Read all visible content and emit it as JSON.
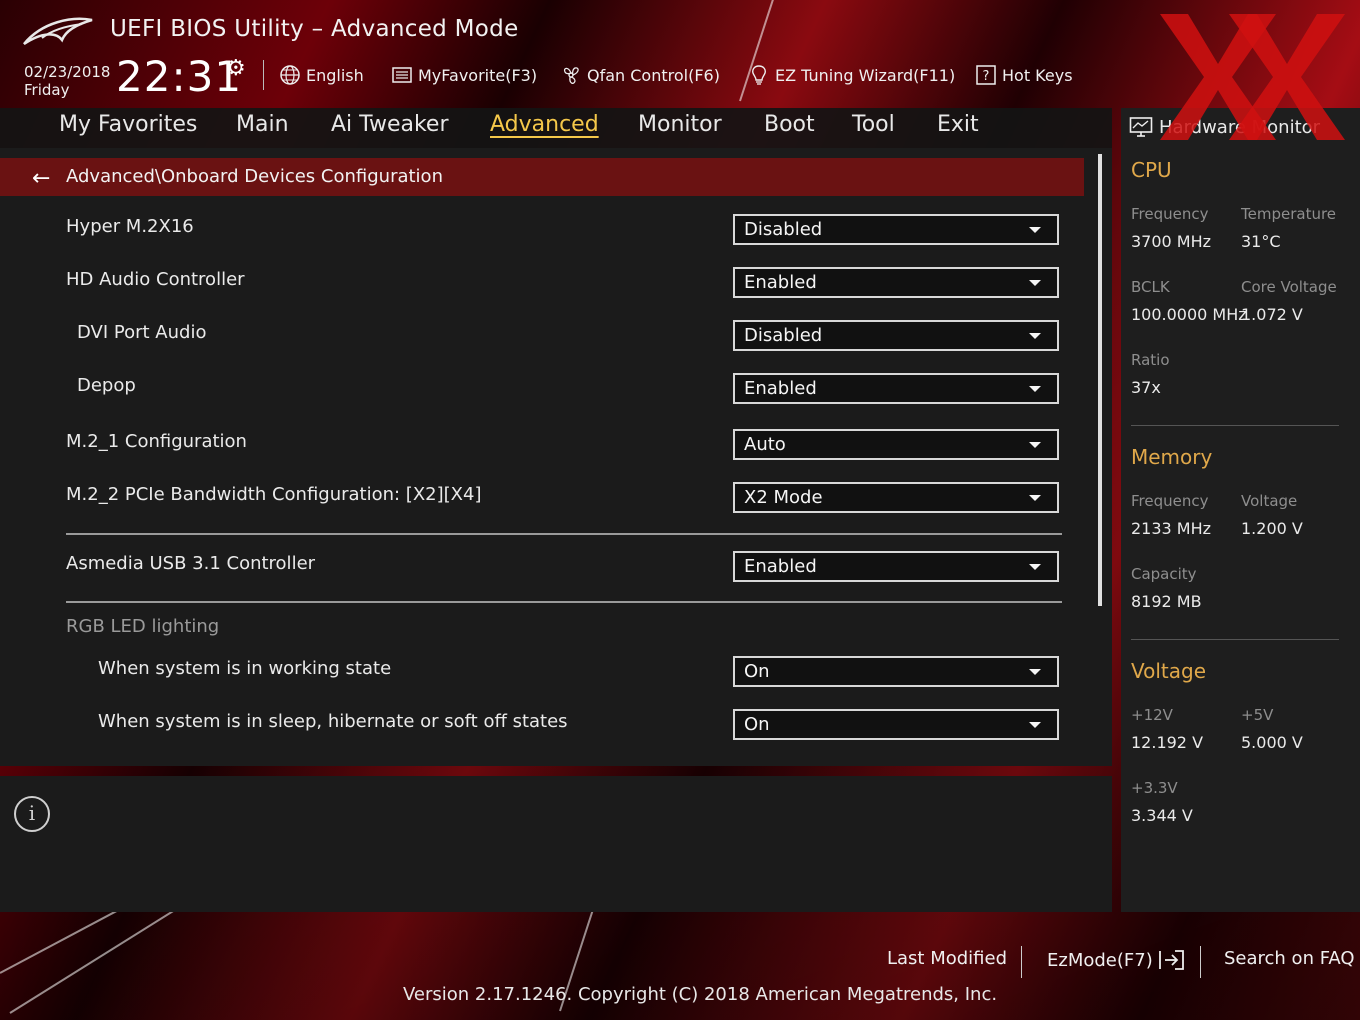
{
  "header": {
    "title": "UEFI BIOS Utility – Advanced Mode",
    "date": "02/23/2018",
    "weekday": "Friday",
    "time": "22:31",
    "toolbar": {
      "language": "English",
      "myfavorite": "MyFavorite(F3)",
      "qfan": "Qfan Control(F6)",
      "ez_tuning": "EZ Tuning Wizard(F11)",
      "hot_keys": "Hot Keys"
    }
  },
  "tabs": [
    "My Favorites",
    "Main",
    "Ai Tweaker",
    "Advanced",
    "Monitor",
    "Boot",
    "Tool",
    "Exit"
  ],
  "active_tab": "Advanced",
  "breadcrumb": "Advanced\\Onboard Devices Configuration",
  "settings": [
    {
      "label": "Hyper M.2X16",
      "value": "Disabled"
    },
    {
      "label": "HD Audio Controller",
      "value": "Enabled"
    },
    {
      "label": "DVI Port Audio",
      "value": "Disabled"
    },
    {
      "label": "Depop",
      "value": "Enabled"
    },
    {
      "label": "M.2_1 Configuration",
      "value": "Auto"
    },
    {
      "label": "M.2_2 PCIe Bandwidth Configuration: [X2][X4]",
      "value": "X2 Mode"
    },
    {
      "label": "Asmedia USB 3.1 Controller",
      "value": "Enabled"
    },
    {
      "label": "When system is in working state",
      "value": "On"
    },
    {
      "label": "When system is in sleep, hibernate or soft off states",
      "value": "On"
    }
  ],
  "rgb_section": "RGB LED lighting",
  "hardware_monitor": {
    "title": "Hardware Monitor",
    "cpu": {
      "heading": "CPU",
      "frequency_label": "Frequency",
      "frequency": "3700 MHz",
      "temperature_label": "Temperature",
      "temperature": "31°C",
      "bclk_label": "BCLK",
      "bclk": "100.0000 MHz",
      "core_voltage_label": "Core Voltage",
      "core_voltage": "1.072 V",
      "ratio_label": "Ratio",
      "ratio": "37x"
    },
    "memory": {
      "heading": "Memory",
      "frequency_label": "Frequency",
      "frequency": "2133 MHz",
      "voltage_label": "Voltage",
      "voltage": "1.200 V",
      "capacity_label": "Capacity",
      "capacity": "8192 MB"
    },
    "voltage": {
      "heading": "Voltage",
      "v12_label": "+12V",
      "v12": "12.192 V",
      "v5_label": "+5V",
      "v5": "5.000 V",
      "v33_label": "+3.3V",
      "v33": "3.344 V"
    }
  },
  "footer": {
    "last_modified": "Last Modified",
    "ezmode": "EzMode(F7)",
    "search_faq": "Search on FAQ",
    "version": "Version 2.17.1246. Copyright (C) 2018 American Megatrends, Inc."
  },
  "colors": {
    "accent_active_tab": "#f5c84a",
    "section_heading": "#e0a84a",
    "breadcrumb_bg": "#6a1212",
    "watermark": "#d01010"
  }
}
